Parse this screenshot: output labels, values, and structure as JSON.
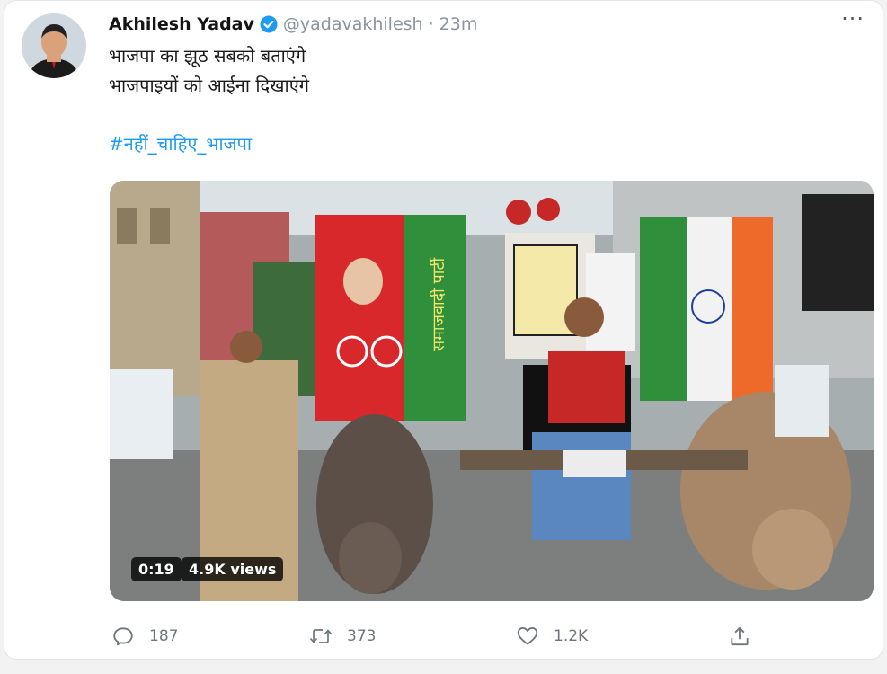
{
  "tweet": {
    "author_name": "Akhilesh Yadav",
    "handle": "@yadavakhilesh",
    "separator": "·",
    "time": "23m",
    "more_label": "···",
    "text_line1": "भाजपा का झूठ सबको बताएंगे",
    "text_line2": "भाजपाइयों को आईना दिखाएंगे",
    "hashtag": "#नहीं_चाहिए_भाजपा"
  },
  "media": {
    "duration": "0:19",
    "views": "4.9K views",
    "banner_text": "समाजवादी पार्टी"
  },
  "actions": {
    "reply_count": "187",
    "retweet_count": "373",
    "like_count": "1.2K"
  },
  "colors": {
    "link": "#1d9bf0",
    "verified": "#1d9bf0",
    "muted": "#6e767d"
  }
}
